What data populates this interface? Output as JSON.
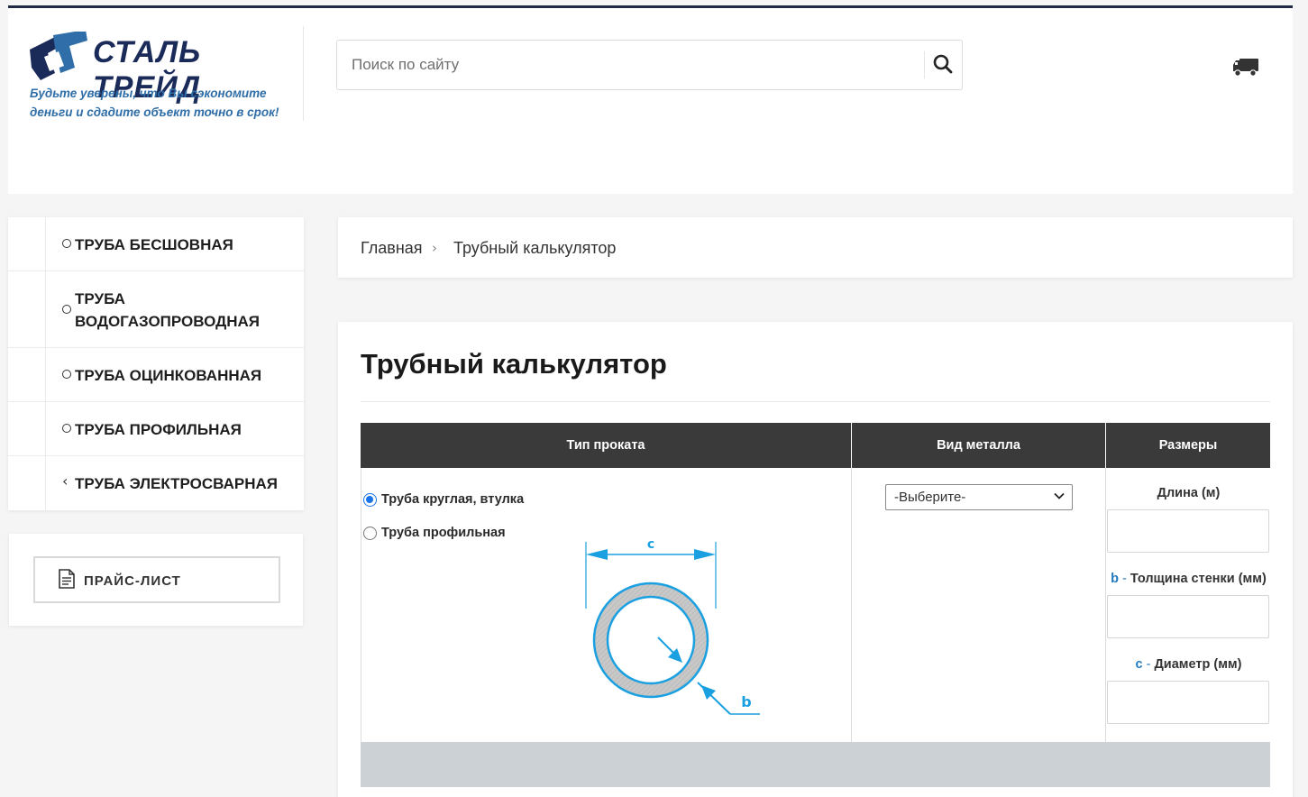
{
  "header": {
    "logo_text": "СТАЛЬ ТРЕЙД",
    "slogan": "Будьте уверены, что Вы сэкономите деньги и сдадите объект точно в срок!",
    "search_placeholder": "Поиск по сайту"
  },
  "sidebar": {
    "items": [
      {
        "label": "Труба бесшовная",
        "marker": "circle"
      },
      {
        "label": "Труба водогазопроводная",
        "marker": "circle"
      },
      {
        "label": "Труба оцинкованная",
        "marker": "circle"
      },
      {
        "label": "Труба профильная",
        "marker": "circle"
      },
      {
        "label": "Труба электросварная",
        "marker": "‹"
      }
    ],
    "price_list_label": "ПРАЙС-ЛИСТ"
  },
  "breadcrumb": {
    "home": "Главная",
    "separator": "›",
    "current": "Трубный калькулятор"
  },
  "main": {
    "title": "Трубный калькулятор",
    "table": {
      "headers": [
        "Тип проката",
        "Вид металла",
        "Размеры"
      ],
      "rolling_types": [
        {
          "label": "Труба круглая, втулка",
          "selected": true
        },
        {
          "label": "Труба профильная",
          "selected": false
        }
      ],
      "metal_select": "-Выберите-",
      "dimensions": {
        "length_label": "Длина (м)",
        "wall_key": "b",
        "wall_label": "Толщина стенки (мм)",
        "diameter_key": "c",
        "diameter_label": "Диаметр (мм)",
        "dash": " - "
      },
      "diagram_labels": {
        "diameter": "c",
        "wall": "b"
      }
    }
  },
  "colors": {
    "brand_navy": "#1a2b5a",
    "slogan_blue": "#2f6ea8",
    "table_header": "#3a3a3a",
    "key_blue": "#1f7ac0",
    "diagram_blue": "#1aa0e0",
    "result_bar": "#ccd1d6"
  }
}
